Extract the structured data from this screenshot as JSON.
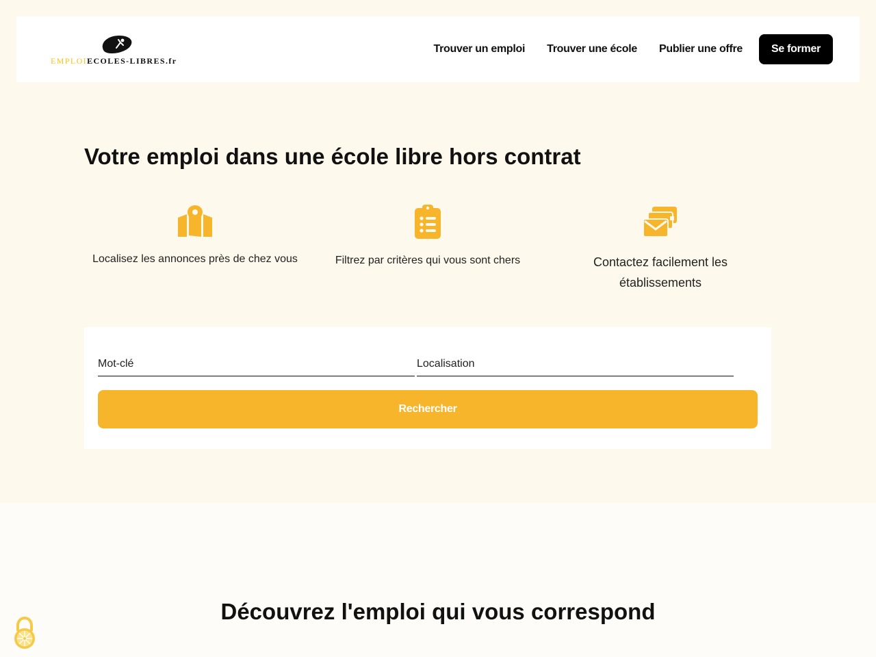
{
  "header": {
    "logo": {
      "text_part1": "EMPLOI",
      "text_part2": "ECOLES-LIBRES.fr"
    },
    "nav": {
      "find_job": "Trouver un emploi",
      "find_school": "Trouver une école",
      "post_offer": "Publier une offre",
      "train_button": "Se former"
    }
  },
  "hero": {
    "title_pre": "Votre ",
    "title_bold": "emploi",
    "title_post": " dans une école libre hors contrat",
    "features": [
      {
        "icon": "map-pin-icon",
        "text": "Localisez les annonces près de chez vous"
      },
      {
        "icon": "clipboard-list-icon",
        "text": "Filtrez par critères qui vous sont chers"
      },
      {
        "icon": "envelopes-icon",
        "text": "Contactez facilement les établissements"
      }
    ]
  },
  "search": {
    "keyword_placeholder": "Mot-clé",
    "location_placeholder": "Localisation",
    "button_label": "Rechercher"
  },
  "discover": {
    "title_pre": "Découvrez l'emploi ",
    "title_bold": "qui vous correspond"
  },
  "colors": {
    "accent": "#f7b52c",
    "background": "#fdf9ec",
    "header_bg": "#ffffff",
    "button_dark": "#000000"
  },
  "icons": {
    "lock": "lock-icon"
  }
}
